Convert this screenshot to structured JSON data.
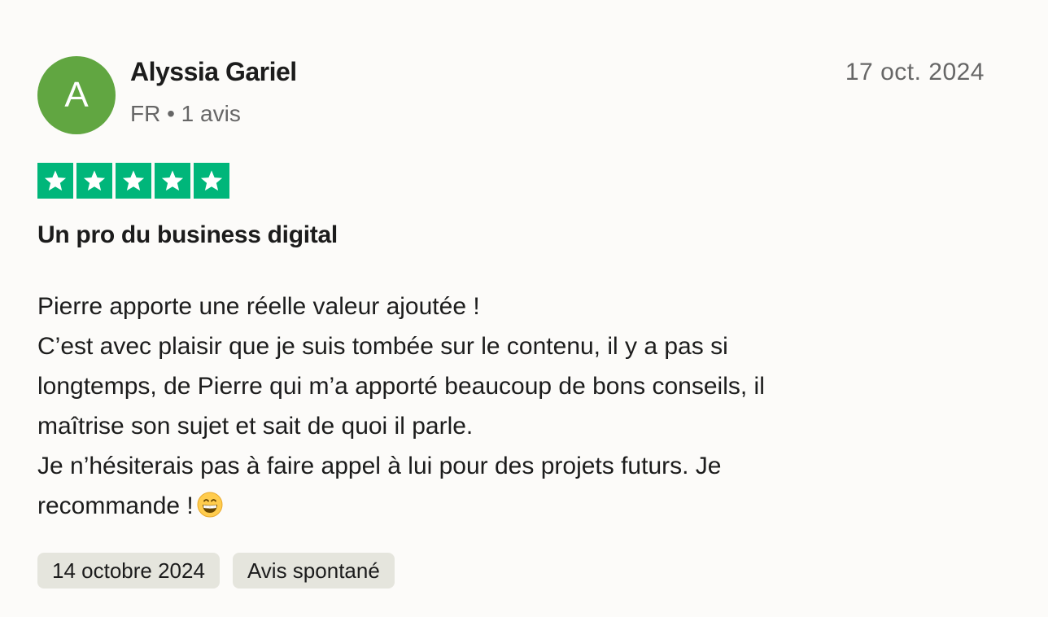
{
  "author": {
    "initial": "A",
    "name": "Alyssia Gariel",
    "meta": "FR • 1 avis",
    "avatar_color": "#61a641"
  },
  "review": {
    "date": "17 oct. 2024",
    "rating": 5,
    "rating_max": 5,
    "star_color": "#00b67a",
    "title": "Un pro du business digital",
    "body_lines": [
      "Pierre apporte une réelle valeur ajoutée !",
      "C’est avec plaisir que je suis tombée sur le contenu, il y a pas si",
      "longtemps, de Pierre qui m’a apporté beaucoup de bons conseils, il",
      "maîtrise son sujet et sait de quoi il parle.",
      "Je n’hésiterais pas à faire appel à lui pour des projets futurs. Je",
      "recommande !"
    ],
    "emoji": "grinning-face-icon"
  },
  "tags": [
    "14 octobre 2024",
    "Avis spontané"
  ]
}
